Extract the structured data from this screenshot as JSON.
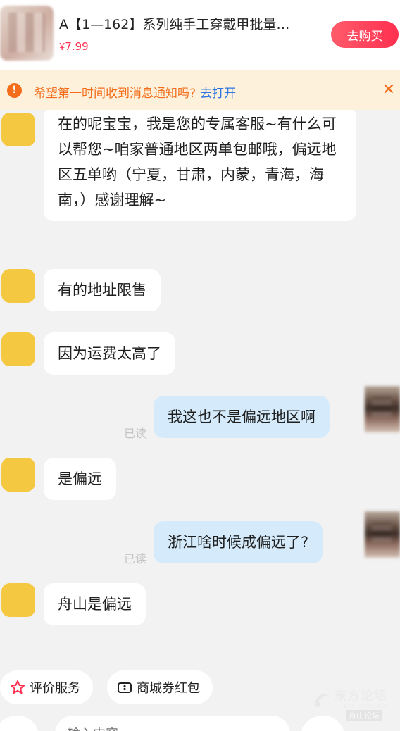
{
  "header": {
    "product_title": "A【1—162】系列纯手工穿戴甲批量…",
    "price_currency": "¥",
    "price_value": "7.99",
    "buy_label": "去购买"
  },
  "notice": {
    "text": "希望第一时间收到消息通知吗?",
    "link_label": "去打开",
    "close_symbol": "✕"
  },
  "messages": [
    {
      "side": "in",
      "text": "在的呢宝宝，我是您的专属客服~有什么可以帮您~咱家普通地区两单包邮哦，偏远地区五单哟（宁夏，甘肃，内蒙，青海，海南，）感谢理解~"
    },
    {
      "side": "in",
      "text": "有的地址限售"
    },
    {
      "side": "in",
      "text": "因为运费太高了"
    },
    {
      "side": "out",
      "text": "我这也不是偏远地区啊",
      "status": "已读"
    },
    {
      "side": "in",
      "text": "是偏远"
    },
    {
      "side": "out",
      "text": "浙江啥时候成偏远了?",
      "status": "已读"
    },
    {
      "side": "in",
      "text": "舟山是偏远"
    }
  ],
  "quick_actions": [
    {
      "label": "评价服务",
      "icon": "star-icon"
    },
    {
      "label": "商城券红包",
      "icon": "coupon-icon"
    }
  ],
  "input": {
    "placeholder": "输入内容"
  },
  "watermark": {
    "main": "东方论坛",
    "sub": "bbs.cnsoc.net",
    "tag": "舟山论坛"
  },
  "colors": {
    "accent_red": "#ff2f4f",
    "notice_orange": "#f36d1a",
    "link_blue": "#2f76e0",
    "outgoing_bubble": "#d5ebfb",
    "incoming_bubble": "#ffffff",
    "support_avatar": "#f5c842"
  }
}
